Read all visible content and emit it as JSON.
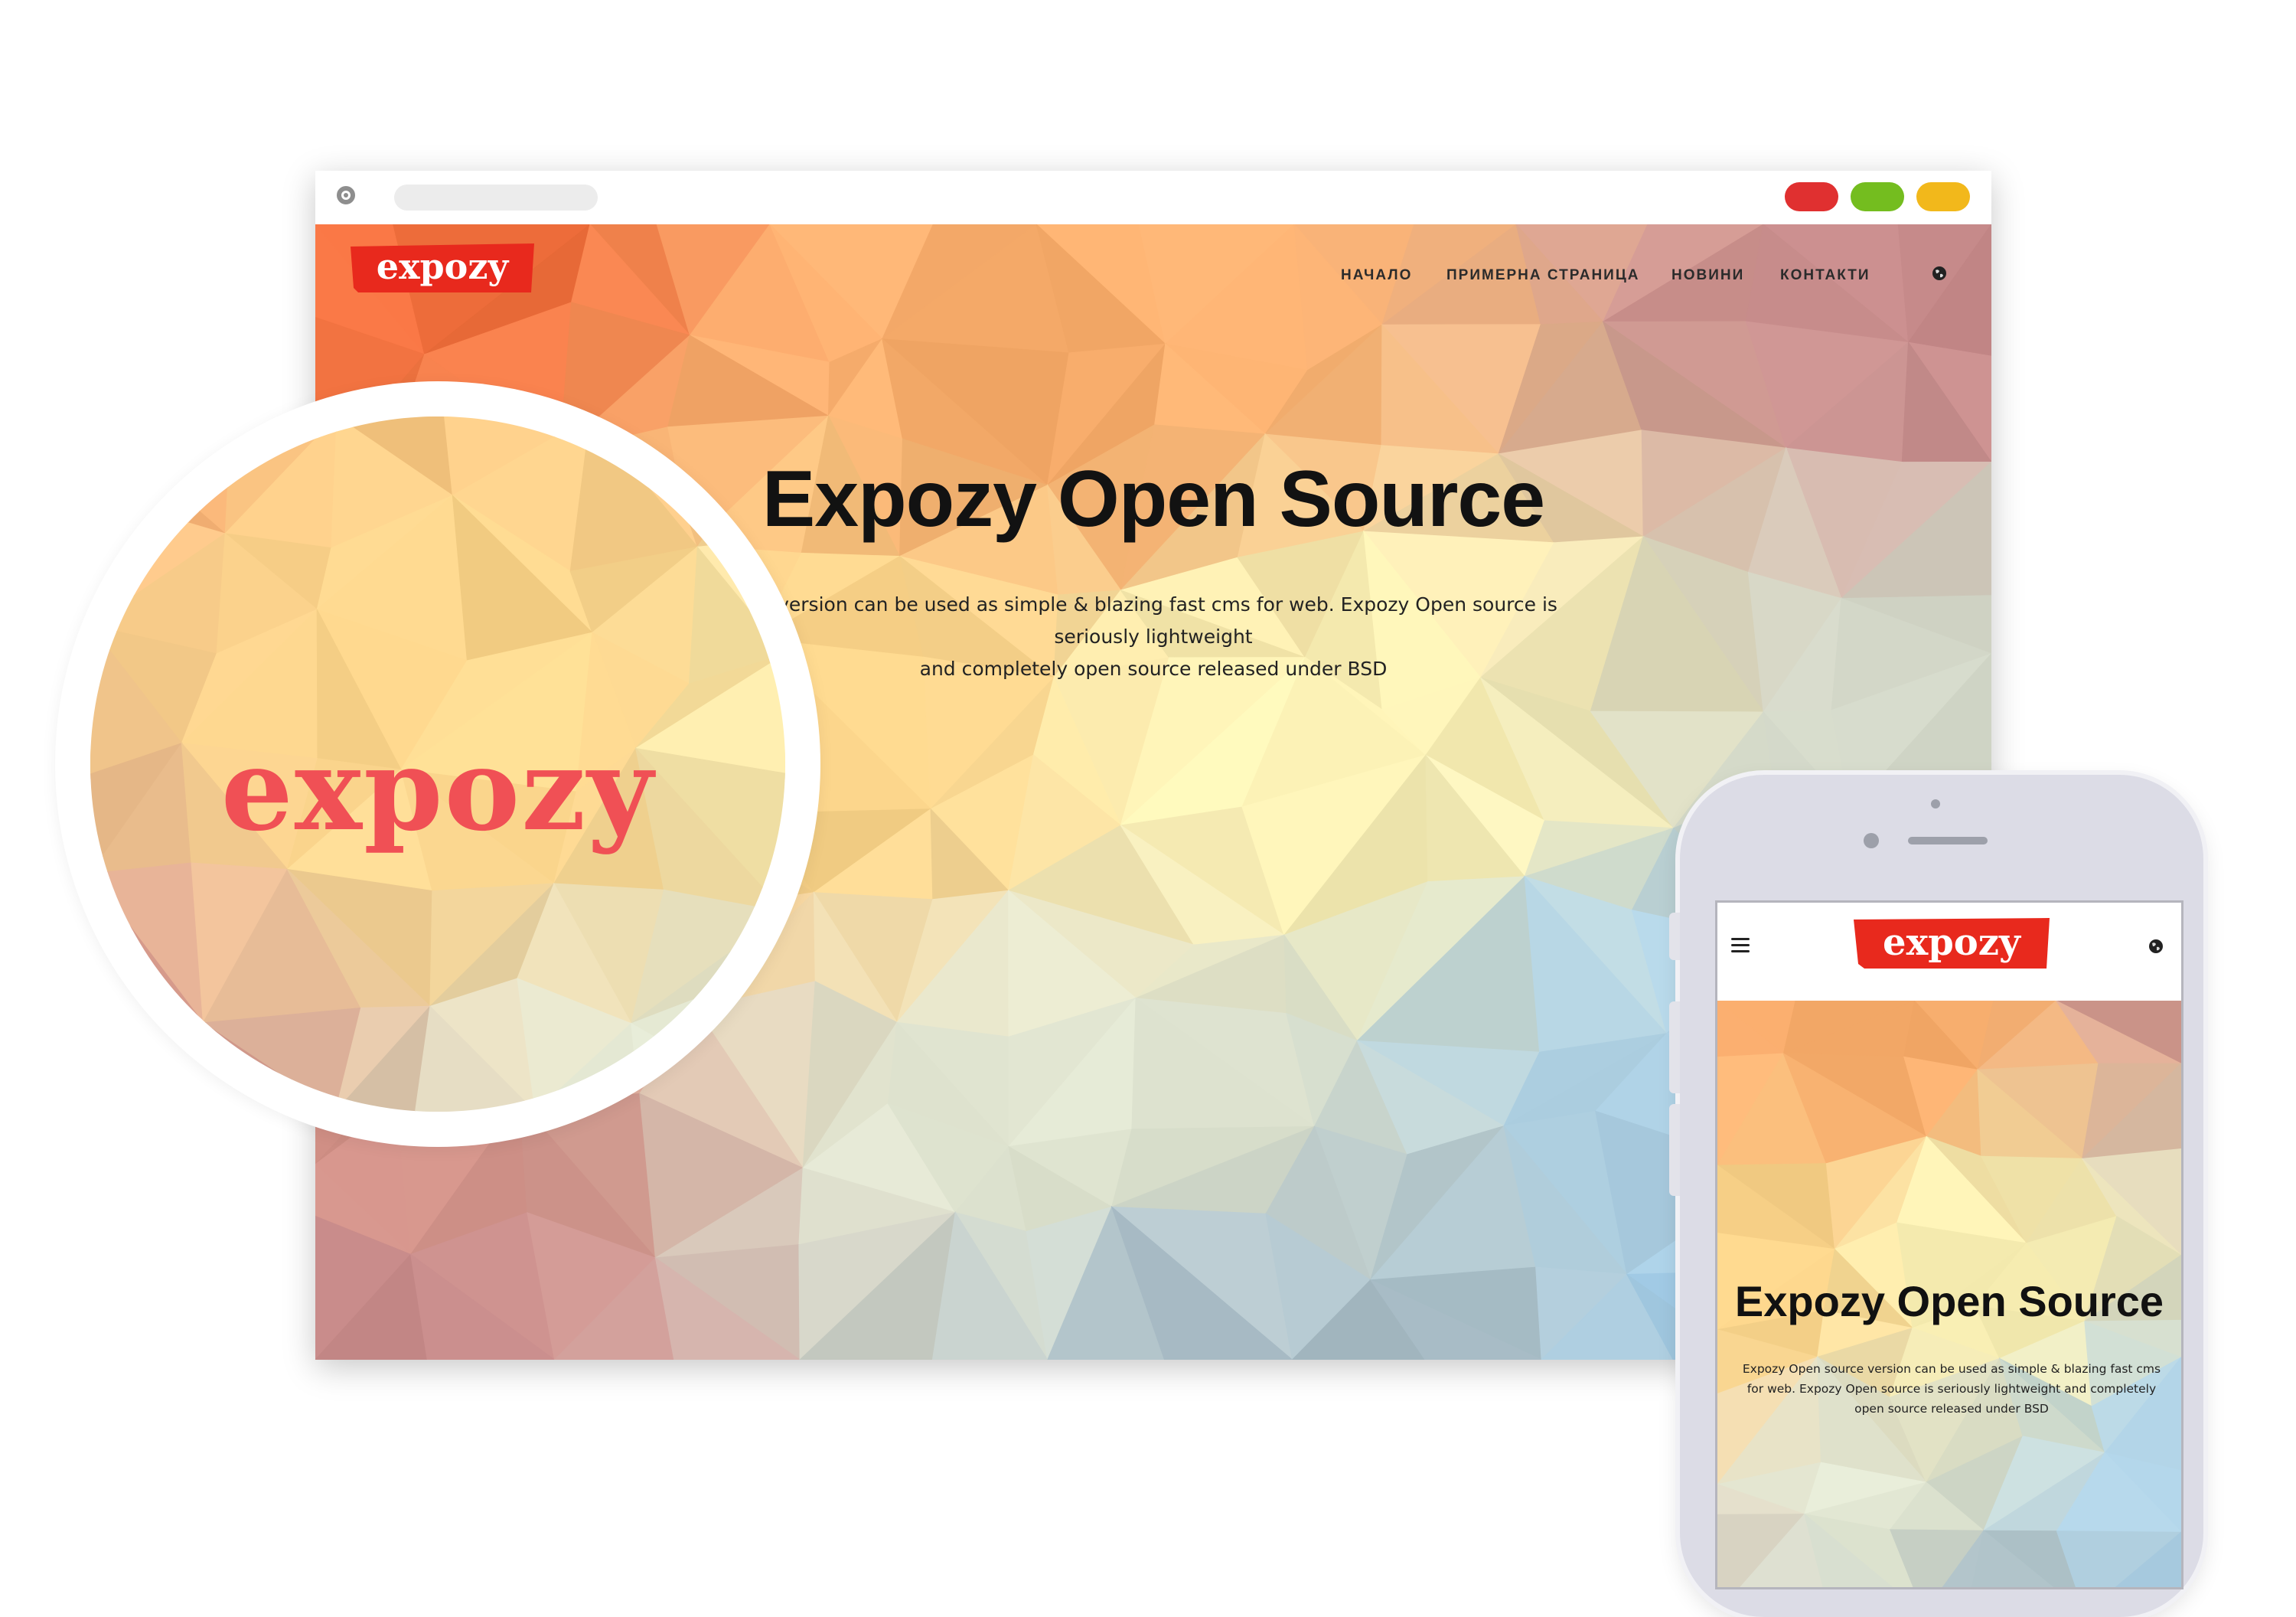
{
  "brand": {
    "logo_text": "expozy",
    "logo_color": "#e8291d"
  },
  "browser": {
    "controls": {
      "red": "#e03030",
      "green": "#74bd1f",
      "yellow": "#f2b81b"
    }
  },
  "nav": {
    "items": [
      "НАЧАЛО",
      "ПРИМЕРНА СТРАНИЦА",
      "НОВИНИ",
      "КОНТАКТИ"
    ],
    "language_icon": "globe-icon"
  },
  "hero": {
    "title": "Expozy Open Source",
    "text_line1": "ce version can be used as simple & blazing fast cms for web. Expozy Open source is seriously lightweight",
    "text_line2": "and completely open source released under BSD"
  },
  "magnifier": {
    "word": "expozy"
  },
  "mobile": {
    "menu_icon": "hamburger-menu-icon",
    "title": "Expozy Open Source",
    "text": "Expozy Open source version can be used as simple & blazing fast cms for web. Expozy Open source is seriously lightweight and completely open source released under BSD"
  }
}
